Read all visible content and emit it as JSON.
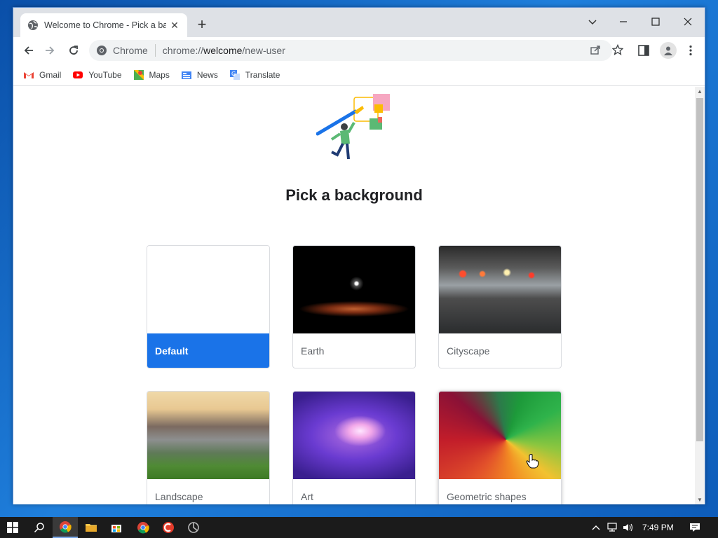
{
  "window": {
    "tab_title": "Welcome to Chrome - Pick a bac",
    "new_tab_symbol": "+"
  },
  "toolbar": {
    "chip_label": "Chrome",
    "url_prefix": "chrome://",
    "url_host": "welcome",
    "url_path": "/new-user"
  },
  "bookmarks": [
    {
      "label": "Gmail",
      "icon": "gmail-icon"
    },
    {
      "label": "YouTube",
      "icon": "youtube-icon"
    },
    {
      "label": "Maps",
      "icon": "maps-icon"
    },
    {
      "label": "News",
      "icon": "news-icon"
    },
    {
      "label": "Translate",
      "icon": "translate-icon"
    }
  ],
  "page": {
    "heading": "Pick a background",
    "backgrounds": [
      {
        "label": "Default",
        "selected": true
      },
      {
        "label": "Earth",
        "selected": false
      },
      {
        "label": "Cityscape",
        "selected": false
      },
      {
        "label": "Landscape",
        "selected": false
      },
      {
        "label": "Art",
        "selected": false
      },
      {
        "label": "Geometric shapes",
        "selected": false
      }
    ]
  },
  "taskbar": {
    "clock": "7:49 PM"
  },
  "colors": {
    "accent": "#1a73e8",
    "titlebar": "#dee1e6",
    "taskbar": "#1b1b1b"
  }
}
